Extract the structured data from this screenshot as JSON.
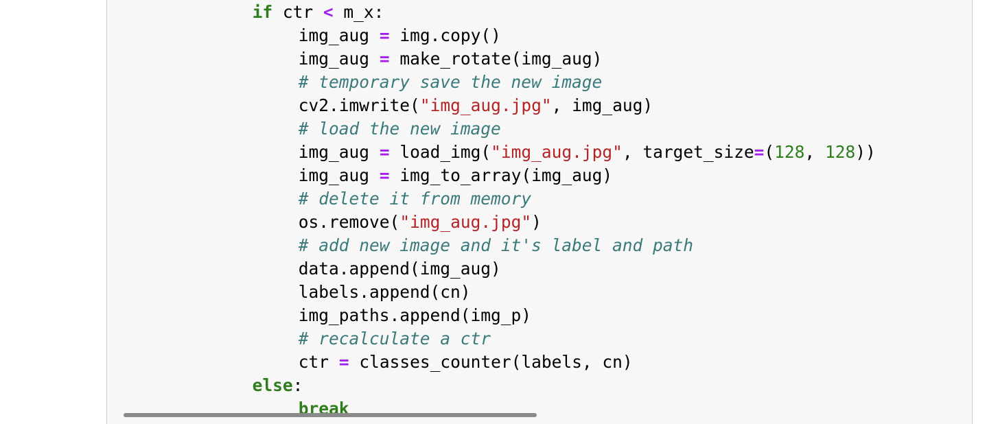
{
  "code_lines": [
    {
      "indent": 12,
      "tokens": [
        {
          "t": "kw",
          "v": "if"
        },
        {
          "t": "plain",
          "v": " ctr "
        },
        {
          "t": "op",
          "v": "<"
        },
        {
          "t": "plain",
          "v": " m_x:"
        }
      ]
    },
    {
      "indent": 16,
      "tokens": [
        {
          "t": "plain",
          "v": "img_aug "
        },
        {
          "t": "op",
          "v": "="
        },
        {
          "t": "plain",
          "v": " img.copy()"
        }
      ]
    },
    {
      "indent": 16,
      "tokens": [
        {
          "t": "plain",
          "v": "img_aug "
        },
        {
          "t": "op",
          "v": "="
        },
        {
          "t": "plain",
          "v": " make_rotate(img_aug)"
        }
      ]
    },
    {
      "indent": 16,
      "tokens": [
        {
          "t": "cm",
          "v": "# temporary save the new image"
        }
      ]
    },
    {
      "indent": 16,
      "tokens": [
        {
          "t": "plain",
          "v": "cv2.imwrite("
        },
        {
          "t": "str",
          "v": "\"img_aug.jpg\""
        },
        {
          "t": "plain",
          "v": ", img_aug)"
        }
      ]
    },
    {
      "indent": 16,
      "tokens": [
        {
          "t": "cm",
          "v": "# load the new image"
        }
      ]
    },
    {
      "indent": 16,
      "tokens": [
        {
          "t": "plain",
          "v": "img_aug "
        },
        {
          "t": "op",
          "v": "="
        },
        {
          "t": "plain",
          "v": " load_img("
        },
        {
          "t": "str",
          "v": "\"img_aug.jpg\""
        },
        {
          "t": "plain",
          "v": ", target_size"
        },
        {
          "t": "op",
          "v": "="
        },
        {
          "t": "plain",
          "v": "("
        },
        {
          "t": "num",
          "v": "128"
        },
        {
          "t": "plain",
          "v": ", "
        },
        {
          "t": "num",
          "v": "128"
        },
        {
          "t": "plain",
          "v": "))"
        }
      ]
    },
    {
      "indent": 16,
      "tokens": [
        {
          "t": "plain",
          "v": "img_aug "
        },
        {
          "t": "op",
          "v": "="
        },
        {
          "t": "plain",
          "v": " img_to_array(img_aug)"
        }
      ]
    },
    {
      "indent": 16,
      "tokens": [
        {
          "t": "cm",
          "v": "# delete it from memory"
        }
      ]
    },
    {
      "indent": 16,
      "tokens": [
        {
          "t": "plain",
          "v": "os.remove("
        },
        {
          "t": "str",
          "v": "\"img_aug.jpg\""
        },
        {
          "t": "plain",
          "v": ")"
        }
      ]
    },
    {
      "indent": 16,
      "tokens": [
        {
          "t": "cm",
          "v": "# add new image and it's label and path"
        }
      ]
    },
    {
      "indent": 16,
      "tokens": [
        {
          "t": "plain",
          "v": "data.append(img_aug)"
        }
      ]
    },
    {
      "indent": 16,
      "tokens": [
        {
          "t": "plain",
          "v": "labels.append(cn)"
        }
      ]
    },
    {
      "indent": 16,
      "tokens": [
        {
          "t": "plain",
          "v": "img_paths.append(img_p)"
        }
      ]
    },
    {
      "indent": 16,
      "tokens": [
        {
          "t": "cm",
          "v": "# recalculate a ctr"
        }
      ]
    },
    {
      "indent": 16,
      "tokens": [
        {
          "t": "plain",
          "v": "ctr "
        },
        {
          "t": "op",
          "v": "="
        },
        {
          "t": "plain",
          "v": " classes_counter(labels, cn)"
        }
      ]
    },
    {
      "indent": 12,
      "tokens": [
        {
          "t": "kw",
          "v": "else"
        },
        {
          "t": "plain",
          "v": ":"
        }
      ]
    },
    {
      "indent": 16,
      "tokens": [
        {
          "t": "kw",
          "v": "break"
        }
      ]
    }
  ],
  "colors": {
    "keyword": "#2f7d1d",
    "operator": "#a31ff0",
    "string": "#b52323",
    "number": "#2f7d1d",
    "comment": "#3a7a7a",
    "cell_background": "#f7f7f7"
  }
}
